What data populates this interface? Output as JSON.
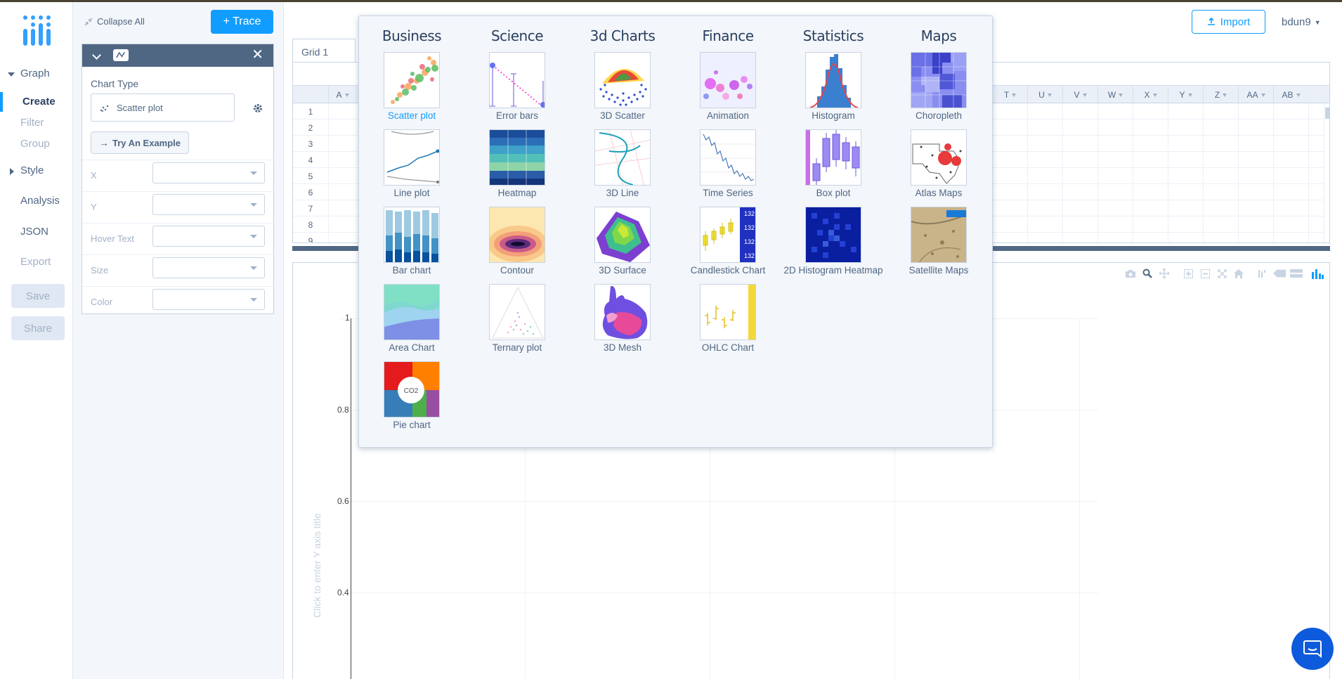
{
  "nav": {
    "graph": "Graph",
    "create": "Create",
    "filter": "Filter",
    "group": "Group",
    "style": "Style",
    "analysis": "Analysis",
    "json": "JSON",
    "export": "Export",
    "save": "Save",
    "share": "Share"
  },
  "panel": {
    "collapse_all": "Collapse All",
    "add_trace": "+ Trace",
    "chart_type_label": "Chart Type",
    "chart_type_value": "Scatter plot",
    "try_example": "Try An Example",
    "fields": [
      "X",
      "Y",
      "Hover Text",
      "Size",
      "Color"
    ]
  },
  "header": {
    "import": "Import",
    "user": "bdun9"
  },
  "grid": {
    "tab": "Grid 1",
    "columns": [
      "A",
      "T",
      "U",
      "V",
      "W",
      "X",
      "Y",
      "Z",
      "AA",
      "AB"
    ],
    "rows": [
      "1",
      "2",
      "3",
      "4",
      "5",
      "6",
      "7",
      "8",
      "9"
    ]
  },
  "plot": {
    "y_axis_placeholder": "Click to enter Y axis title",
    "y_ticks": [
      "1",
      "0.8",
      "0.6",
      "0.4"
    ]
  },
  "chart_types": {
    "categories": [
      {
        "title": "Business",
        "items": [
          "Scatter plot",
          "Line plot",
          "Bar chart",
          "Area Chart",
          "Pie chart"
        ]
      },
      {
        "title": "Science",
        "items": [
          "Error bars",
          "Heatmap",
          "Contour",
          "Ternary plot"
        ]
      },
      {
        "title": "3d Charts",
        "items": [
          "3D Scatter",
          "3D Line",
          "3D Surface",
          "3D Mesh"
        ]
      },
      {
        "title": "Finance",
        "items": [
          "Animation",
          "Time Series",
          "Candlestick Chart",
          "OHLC Chart"
        ]
      },
      {
        "title": "Statistics",
        "items": [
          "Histogram",
          "Box plot",
          "2D Histogram Heatmap"
        ]
      },
      {
        "title": "Maps",
        "items": [
          "Choropleth",
          "Atlas Maps",
          "Satellite Maps"
        ]
      }
    ],
    "selected": "Scatter plot",
    "pie_thumb_text": "CO2"
  },
  "colors": {
    "accent": "#119dff",
    "panel_header": "#506784",
    "text": "#506784",
    "muted": "#a2b1c6"
  }
}
